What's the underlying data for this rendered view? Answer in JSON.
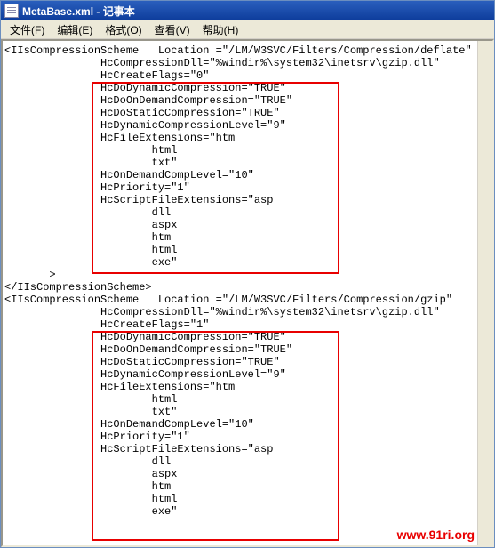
{
  "title": "MetaBase.xml - 记事本",
  "menu": {
    "file": "文件(F)",
    "edit": "编辑(E)",
    "format": "格式(O)",
    "view": "查看(V)",
    "help": "帮助(H)"
  },
  "content_lines": [
    "<IIsCompressionScheme   Location =\"/LM/W3SVC/Filters/Compression/deflate\"",
    "               HcCompressionDll=\"%windir%\\system32\\inetsrv\\gzip.dll\"",
    "               HcCreateFlags=\"0\"",
    "               HcDoDynamicCompression=\"TRUE\"",
    "               HcDoOnDemandCompression=\"TRUE\"",
    "               HcDoStaticCompression=\"TRUE\"",
    "               HcDynamicCompressionLevel=\"9\"",
    "               HcFileExtensions=\"htm",
    "                       html",
    "                       txt\"",
    "               HcOnDemandCompLevel=\"10\"",
    "               HcPriority=\"1\"",
    "               HcScriptFileExtensions=\"asp",
    "                       dll",
    "                       aspx",
    "                       htm",
    "                       html",
    "                       exe\"",
    "       >",
    "</IIsCompressionScheme>",
    "<IIsCompressionScheme   Location =\"/LM/W3SVC/Filters/Compression/gzip\"",
    "               HcCompressionDll=\"%windir%\\system32\\inetsrv\\gzip.dll\"",
    "               HcCreateFlags=\"1\"",
    "               HcDoDynamicCompression=\"TRUE\"",
    "               HcDoOnDemandCompression=\"TRUE\"",
    "               HcDoStaticCompression=\"TRUE\"",
    "               HcDynamicCompressionLevel=\"9\"",
    "               HcFileExtensions=\"htm",
    "                       html",
    "                       txt\"",
    "               HcOnDemandCompLevel=\"10\"",
    "               HcPriority=\"1\"",
    "               HcScriptFileExtensions=\"asp",
    "                       dll",
    "                       aspx",
    "                       htm",
    "                       html",
    "                       exe\""
  ],
  "watermark": "www.91ri.org"
}
